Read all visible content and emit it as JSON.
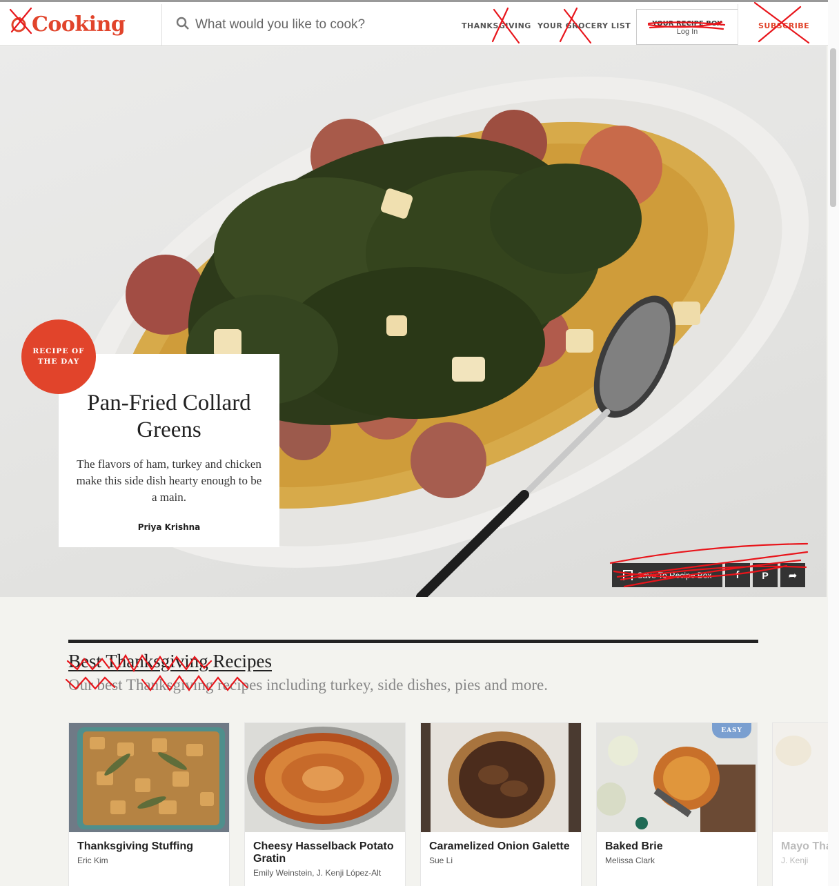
{
  "header": {
    "logo_text": "Cooking",
    "search_placeholder": "What would you like to cook?",
    "nav": {
      "thanksgiving": "THANKSGIVING",
      "grocery": "YOUR GROCERY LIST",
      "recipe_box": "YOUR RECIPE BOX",
      "login": "Log In",
      "subscribe": "SUBSCRIBE"
    }
  },
  "hero": {
    "badge": "RECIPE OF THE DAY",
    "title": "Pan-Fried Collard Greens",
    "description": "The flavors of ham, turkey and chicken make this side dish hearty enough to be a main.",
    "author": "Priya Krishna",
    "save_label": "Save To Recipe Box"
  },
  "collection": {
    "title": "Best Thanksgiving Recipes",
    "subtitle": "Our best Thanksgiving recipes including turkey, side dishes, pies and more.",
    "recipes": [
      {
        "title": "Thanksgiving Stuffing",
        "author": "Eric Kim"
      },
      {
        "title": "Cheesy Hasselback Potato Gratin",
        "author": "Emily Weinstein, J. Kenji López-Alt"
      },
      {
        "title": "Caramelized Onion Galette",
        "author": "Sue Li"
      },
      {
        "title": "Baked Brie",
        "author": "Melissa Clark",
        "badge": "EASY"
      },
      {
        "title": "Mayo Thanksgiving",
        "author": "J. Kenji"
      }
    ]
  },
  "colors": {
    "brand_red": "#e1442b",
    "easy_badge": "#7a9fd0",
    "annotation_red": "#e8151b"
  }
}
